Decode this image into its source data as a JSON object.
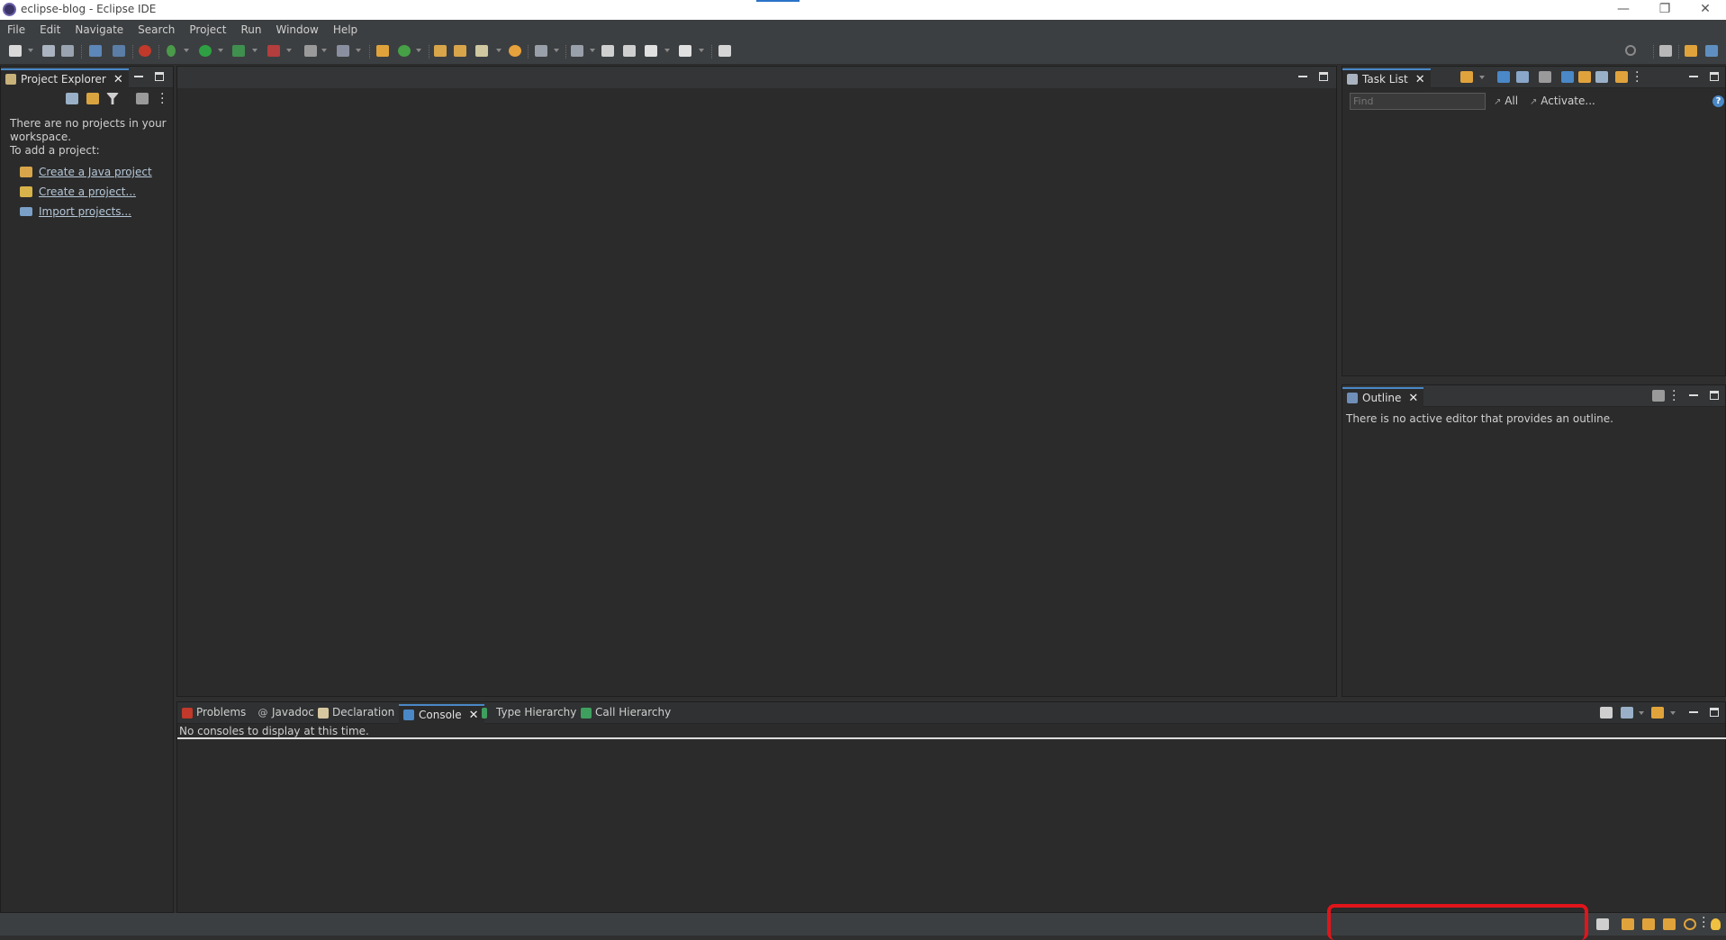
{
  "window": {
    "title": "eclipse-blog - Eclipse IDE",
    "minimize": "—",
    "restore": "❐",
    "close": "✕"
  },
  "menu": [
    "File",
    "Edit",
    "Navigate",
    "Search",
    "Project",
    "Run",
    "Window",
    "Help"
  ],
  "project_explorer": {
    "tab_label": "Project Explorer",
    "close": "✕",
    "empty_line1": "There are no projects in your",
    "empty_line2": "workspace.",
    "empty_line3": "To add a project:",
    "links": [
      "Create a Java project",
      "Create a project...",
      "Import projects..."
    ]
  },
  "task_list": {
    "tab_label": "Task List",
    "close": "✕",
    "find_placeholder": "Find",
    "all_label": "All",
    "activate_label": "Activate...",
    "help": "?"
  },
  "outline": {
    "tab_label": "Outline",
    "close": "✕",
    "empty_message": "There is no active editor that provides an outline."
  },
  "bottom_panel": {
    "tabs": [
      "Problems",
      "Javadoc",
      "Declaration",
      "Console",
      "Type Hierarchy",
      "Call Hierarchy"
    ],
    "active_tab": "Console",
    "close": "✕",
    "console_message": "No consoles to display at this time."
  },
  "colors": {
    "highlight_box": "#e0151b",
    "accent": "#4a88c7"
  }
}
